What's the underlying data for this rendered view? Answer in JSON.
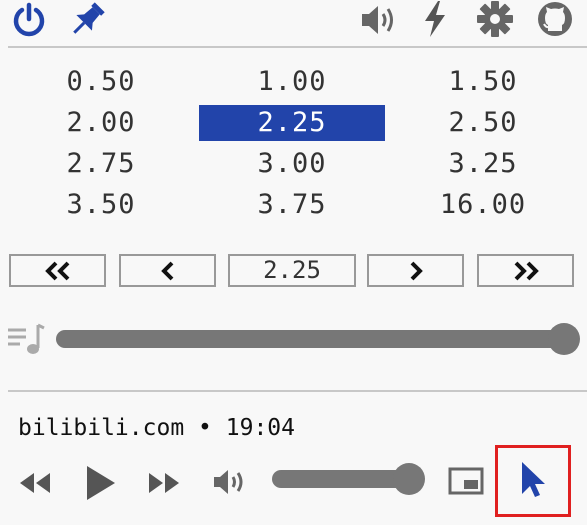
{
  "toolbar": {
    "left_icons": [
      "power-icon",
      "pin-icon"
    ],
    "right_icons": [
      "volume-icon",
      "lightning-icon",
      "gear-icon",
      "github-icon"
    ],
    "accent_color": "#2244aa"
  },
  "speed_grid": {
    "rates": [
      "0.50",
      "1.00",
      "1.50",
      "2.00",
      "2.25",
      "2.50",
      "2.75",
      "3.00",
      "3.25",
      "3.50",
      "3.75",
      "16.00"
    ],
    "selected": "2.25"
  },
  "speed_nav": {
    "current_value": "2.25",
    "buttons": [
      "double-chevron-left-icon",
      "chevron-left-icon",
      "chevron-right-icon",
      "double-chevron-right-icon"
    ]
  },
  "speed_slider": {
    "icon": "music-queue-icon",
    "level": 1.0
  },
  "media": {
    "site": "bilibili.com",
    "separator": "•",
    "time": "19:04",
    "volume_level": 0.96,
    "controls": [
      "rewind-icon",
      "play-icon",
      "fast-forward-icon",
      "volume-icon",
      "picture-in-picture-icon",
      "cursor-icon"
    ],
    "highlight_color": "#e02020"
  }
}
